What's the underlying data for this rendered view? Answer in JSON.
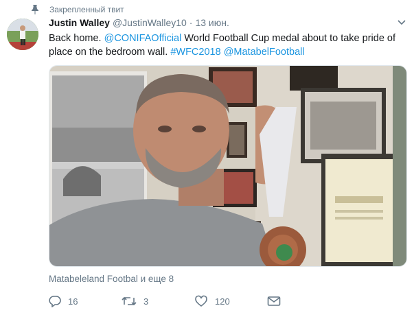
{
  "pinned_label": "Закрепленный твит",
  "tweet": {
    "name": "Justin Walley",
    "handle": "@JustinWalley10",
    "separator": "·",
    "date": "13 июн.",
    "text_parts": {
      "p1": "Back home. ",
      "p2": "@CONIFAOfficial",
      "p3": " World Football Cup medal about to take pride of place on the bedroom wall. ",
      "p4": "#WFC2018",
      "p5": " ",
      "p6": "@MatabelFootball"
    },
    "tagged": "Matabeleland Footbal и еще 8",
    "stats": {
      "replies": "16",
      "retweets": "3",
      "likes": "120"
    }
  },
  "colors": {
    "link": "#1b95e0",
    "secondary": "#657786"
  },
  "icons": [
    "pin-icon",
    "chevron-down-icon",
    "reply-icon",
    "retweet-icon",
    "like-icon",
    "message-icon"
  ]
}
